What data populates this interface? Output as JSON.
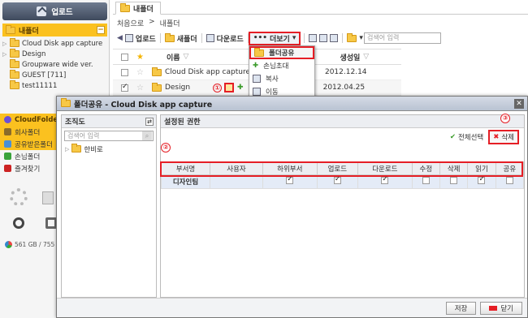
{
  "sidebar": {
    "upload_label": "업로드",
    "my_folder_header": "내폴더",
    "tree": [
      "Cloud Disk app capture",
      "Design",
      "Groupware wide ver.",
      "GUEST [711]",
      "test11111"
    ],
    "cloudfolder_label": "CloudFolder",
    "items": [
      "회사폴더",
      "공유받은폴더",
      "손님폴더",
      "즐겨찾기"
    ],
    "quota_text": "561 GB / 755"
  },
  "main": {
    "tab_label": "내폴더",
    "breadcrumb": [
      "처음으로",
      ">",
      "내폴더"
    ],
    "toolbar": {
      "upload": "업로드",
      "new_folder": "새폴더",
      "download": "다운로드",
      "more": "더보기",
      "search_placeholder": "검색어 입력"
    },
    "list_headers": {
      "name": "이름",
      "created": "생성일"
    },
    "files": [
      {
        "name": "Cloud Disk app capture",
        "date": "2012.12.14",
        "checked": false
      },
      {
        "name": "Design",
        "date": "2012.04.25",
        "checked": true
      }
    ],
    "dropdown": [
      "폴더공유",
      "손님초대",
      "복사",
      "이동"
    ]
  },
  "dialog": {
    "title": "폴더공유 - Cloud Disk app capture",
    "org_header": "조직도",
    "org_search_placeholder": "검색어 입력",
    "org_root": "한비로",
    "perm_header": "설정된 권한",
    "select_all": "전체선택",
    "delete": "삭제",
    "columns": [
      "부서명",
      "사용자",
      "하위부서",
      "업로드",
      "다운로드",
      "수정",
      "삭제",
      "읽기",
      "공유"
    ],
    "rows": [
      {
        "dept": "디자인팀",
        "user": "",
        "sub": true,
        "upload": true,
        "download": true,
        "edit": false,
        "delete": false,
        "read": true,
        "share": false
      }
    ],
    "save": "저장",
    "close": "닫기"
  },
  "annotations": [
    "①",
    "②",
    "③"
  ],
  "colors": {
    "accent_yellow": "#fbc11f",
    "highlight_red": "#e51e25"
  }
}
